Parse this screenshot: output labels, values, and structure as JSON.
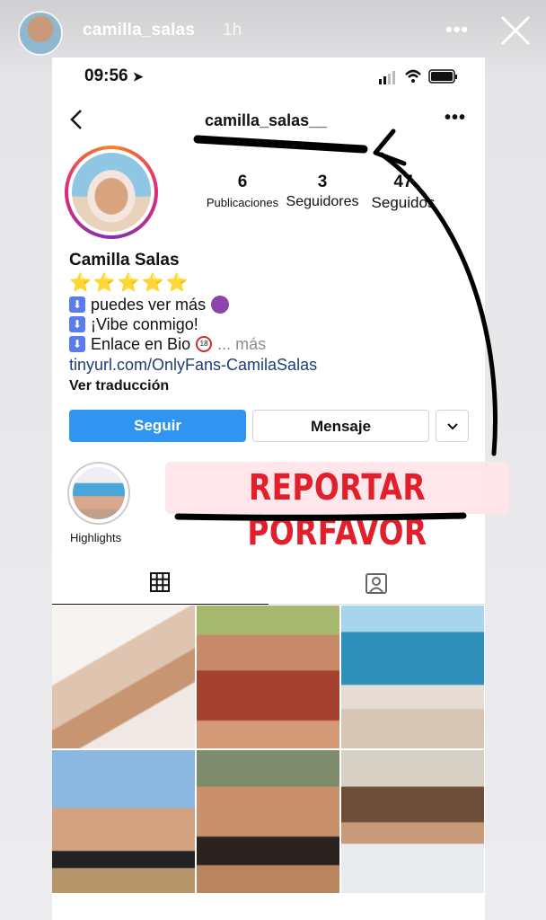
{
  "story": {
    "username": "camilla_salas",
    "time_ago": "1h",
    "more_icon": "more-horizontal-icon",
    "close_icon": "close-icon"
  },
  "status_bar": {
    "time": "09:56"
  },
  "profile": {
    "nav_title": "camilla_salas__",
    "stats": {
      "posts_count": "6",
      "posts_label": "Publicaciones",
      "followers_count": "3",
      "followers_label": "Seguidores",
      "following_count": "47",
      "following_label": "Seguidos"
    },
    "bio": {
      "name": "Camilla Salas",
      "stars": "⭐⭐⭐⭐⭐",
      "line1": "puedes ver más",
      "line2": "¡Vibe conmigo!",
      "line3": "Enlace en Bio",
      "more": "... más",
      "link": "tinyurl.com/OnlyFans-CamilaSalas",
      "translate": "Ver traducción"
    },
    "buttons": {
      "follow": "Seguir",
      "message": "Mensaje",
      "dropdown": "⌄"
    },
    "highlight": {
      "label": "Highlights"
    }
  },
  "overlay": {
    "report_text": "REPORTAR PORFAVOR"
  },
  "colors": {
    "follow_button": "#2f95f0",
    "report_text": "#e2202c",
    "link": "#1e3d7a"
  }
}
